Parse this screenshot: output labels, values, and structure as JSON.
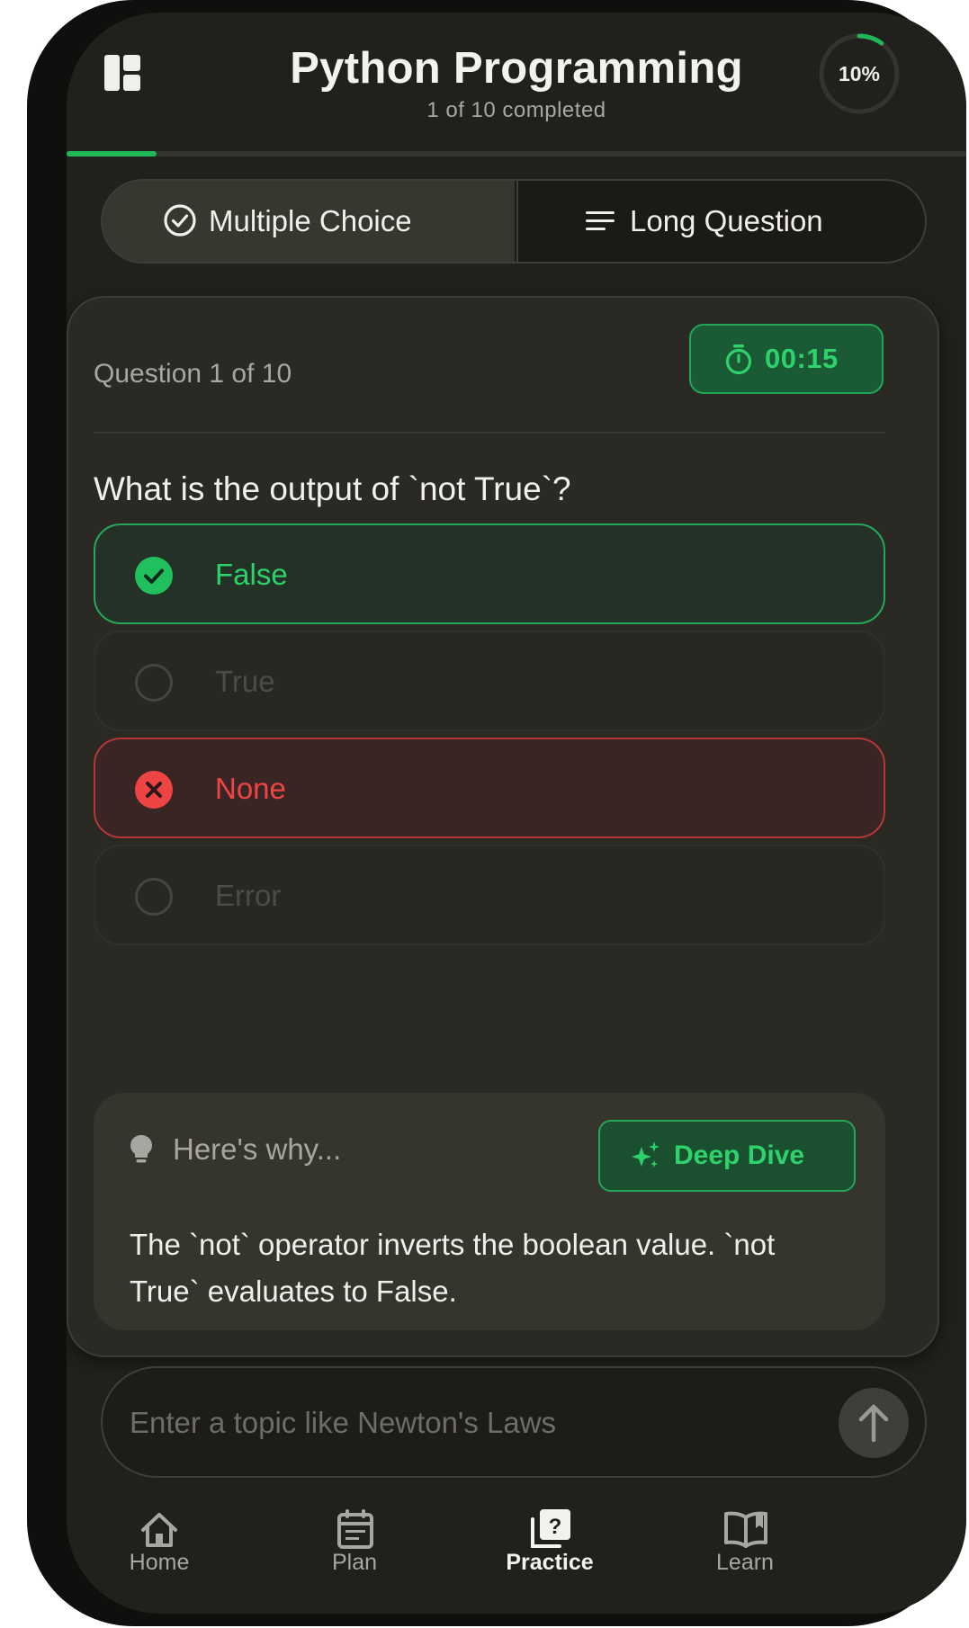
{
  "header": {
    "title": "Python Programming",
    "subtitle": "1 of 10 completed",
    "progress_percent_label": "10%",
    "progress_fraction": 0.1
  },
  "mode_tabs": [
    {
      "label": "Multiple Choice",
      "icon": "check-circle-icon",
      "active": true
    },
    {
      "label": "Long Question",
      "icon": "lines-icon",
      "active": false
    }
  ],
  "quiz": {
    "question_count": "Question 1 of 10",
    "timer": "00:15",
    "question": "What is the output of `not True`?",
    "options": [
      {
        "label": "False",
        "state": "correct"
      },
      {
        "label": "True",
        "state": "disabled"
      },
      {
        "label": "None",
        "state": "wrong"
      },
      {
        "label": "Error",
        "state": "disabled"
      }
    ],
    "explanation": {
      "heading": "Here's why...",
      "deep_dive_label": "Deep Dive",
      "text": "The `not` operator inverts the boolean value. `not True` evaluates to False."
    }
  },
  "topic_input": {
    "placeholder": "Enter a topic like Newton's Laws",
    "value": ""
  },
  "bottom_nav": [
    {
      "label": "Home",
      "icon": "home-icon",
      "active": false
    },
    {
      "label": "Plan",
      "icon": "calendar-icon",
      "active": false
    },
    {
      "label": "Practice",
      "icon": "question-cards-icon",
      "active": true
    },
    {
      "label": "Learn",
      "icon": "open-book-icon",
      "active": false
    }
  ],
  "colors": {
    "accent_green": "#2ed26b",
    "error_red": "#ef4444",
    "background": "#21201c"
  }
}
